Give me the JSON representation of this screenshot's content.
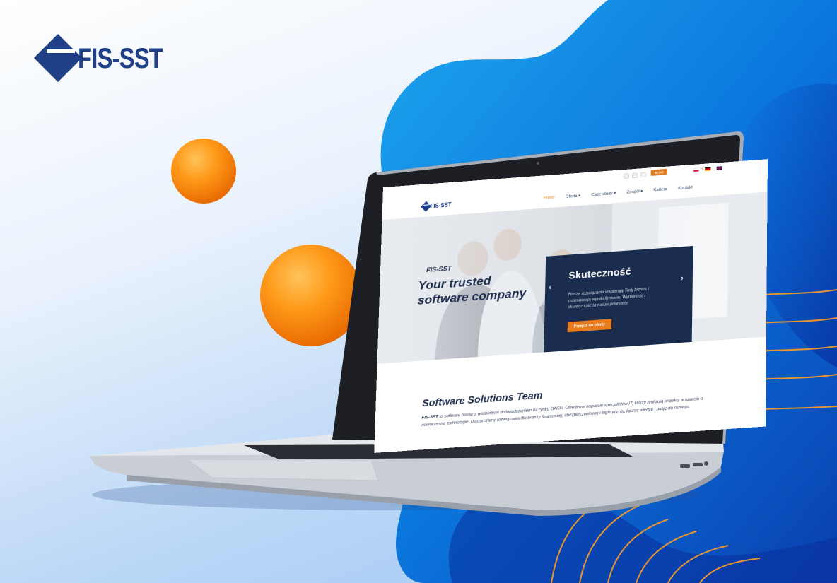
{
  "brand": {
    "name": "FIS-SST"
  },
  "colors": {
    "brand_navy": "#1f3f87",
    "accent_orange": "#e87d1e",
    "dark_card": "#1b2d4f",
    "blue_blob": "#0b6fd6"
  },
  "website": {
    "util_bar": {
      "social_icons": [
        "facebook-icon",
        "linkedin-icon",
        "xing-icon"
      ],
      "blog_label": "BLOG",
      "languages": [
        "pl-flag-icon",
        "de-flag-icon",
        "en-flag-icon"
      ],
      "active_language": "PL"
    },
    "nav": {
      "logo_text": "FIS-SST",
      "links": [
        "Home",
        "Oferta",
        "Case study",
        "Zespół",
        "Kariera",
        "Kontakt"
      ],
      "active_link": "Home"
    },
    "hero": {
      "brand": "FIS-SST",
      "title_line1": "Your trusted",
      "title_line2": "software company",
      "card_title": "Skuteczność",
      "card_text": "Nasze rozwiązania wspierają Twój biznes i usprawniają wyniki firmowe. Wydajność i skuteczność to nasze priorytety.",
      "card_button": "Przejdź do oferty"
    },
    "content": {
      "section_title": "Software Solutions Team",
      "paragraph_brand": "FIS-SST",
      "paragraph": "to software house z wieloletnim doświadczeniem na rynku DACH. Oferujemy wsparcie specjalistów IT, którzy realizują projekty w oparciu o nowoczesne technologie. Dostarczamy rozwiązania dla branży finansowej, ubezpieczeniowej i logistycznej, łącząc wiedzę i pasję do rozwoju."
    }
  }
}
